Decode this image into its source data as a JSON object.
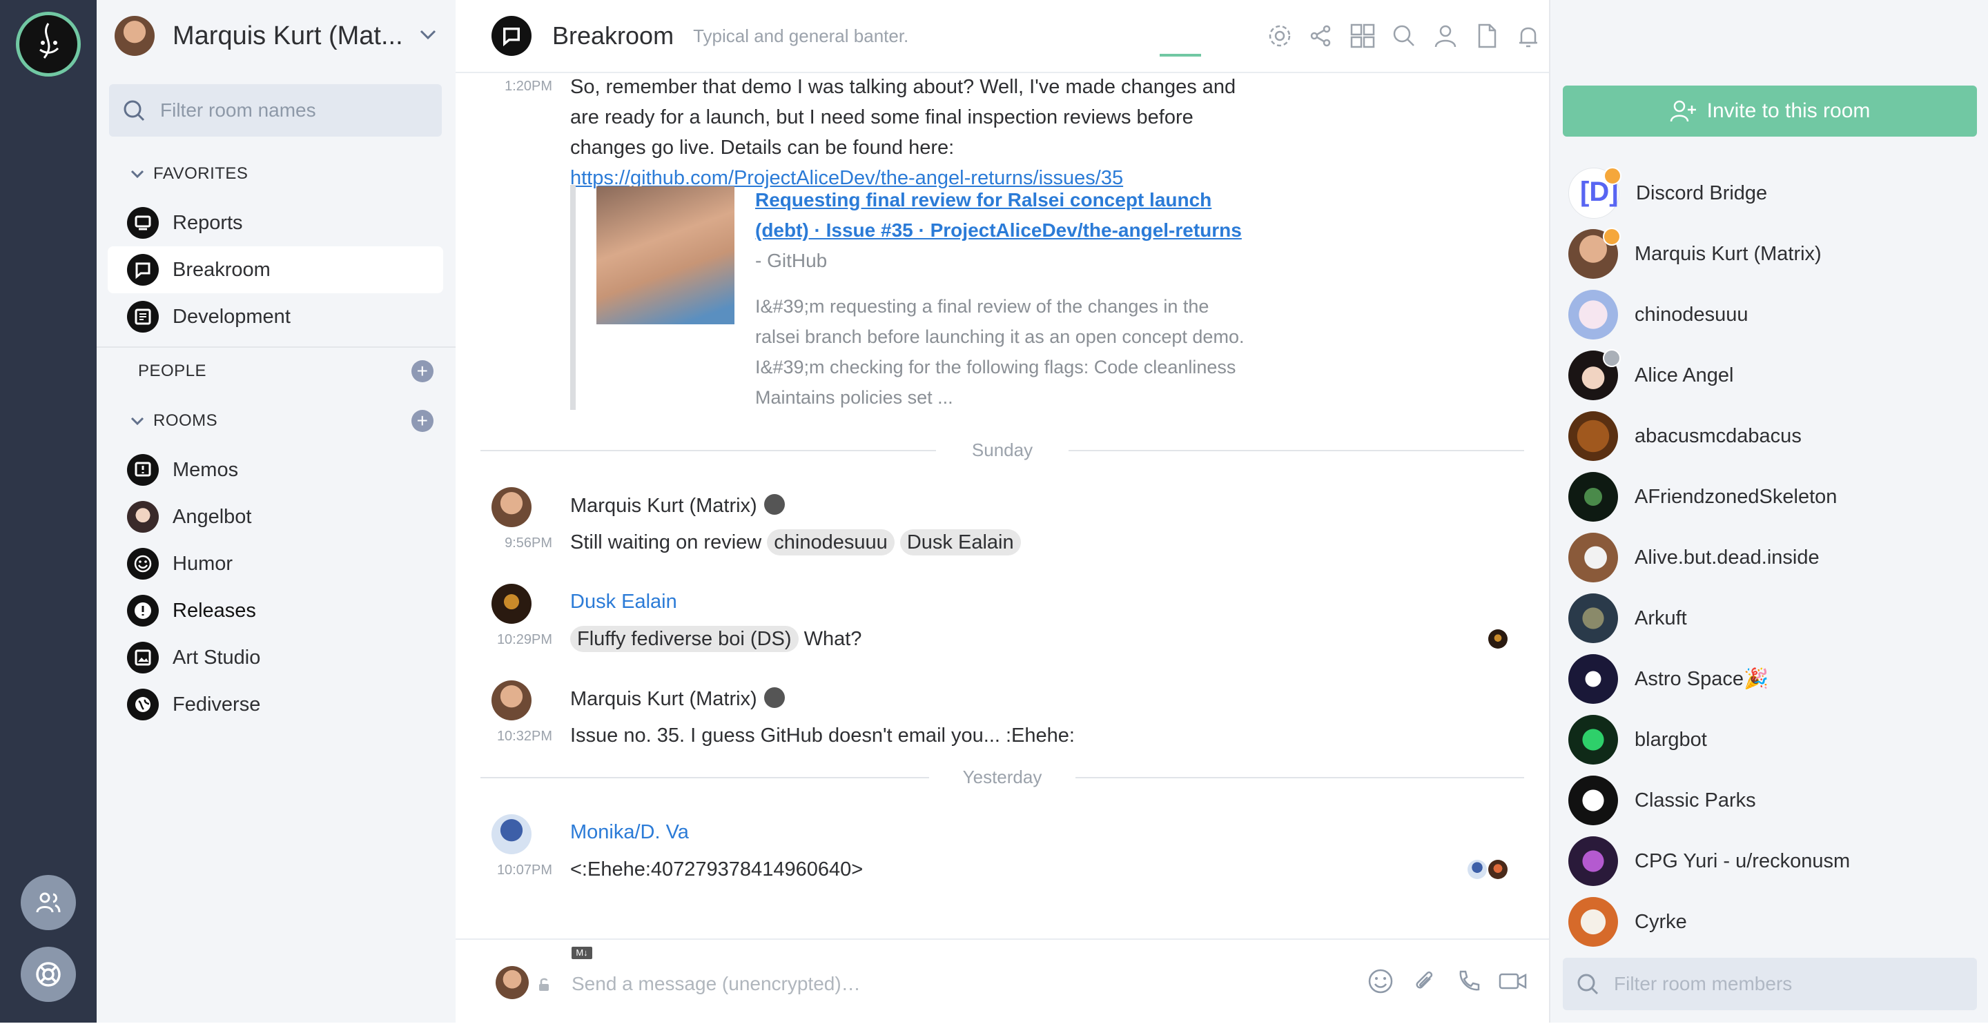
{
  "user_menu": {
    "name": "Marquis Kurt (Mat..."
  },
  "room_filter": {
    "placeholder": "Filter room names"
  },
  "sections": {
    "favorites": "FAVORITES",
    "people": "PEOPLE",
    "rooms": "ROOMS"
  },
  "favorites": [
    {
      "name": "Reports",
      "icon": "report-icon"
    },
    {
      "name": "Breakroom",
      "icon": "chat-bubble-icon"
    },
    {
      "name": "Development",
      "icon": "code-icon"
    }
  ],
  "rooms": [
    {
      "name": "Memos",
      "icon": "memo-icon"
    },
    {
      "name": "Angelbot",
      "icon": "avatar"
    },
    {
      "name": "Humor",
      "icon": "smiley-icon"
    },
    {
      "name": "Releases",
      "icon": "alert-icon"
    },
    {
      "name": "Art Studio",
      "icon": "image-icon"
    },
    {
      "name": "Fediverse",
      "icon": "globe-icon"
    }
  ],
  "room_header": {
    "name": "Breakroom",
    "topic": "Typical and general banter."
  },
  "timeline": {
    "first_message": {
      "time": "1:20PM",
      "text_before": "So, remember that demo I was talking about? Well, I've made changes and are ready for a launch, but I need some final inspection reviews before changes go live. Details can be found here: ",
      "link": "https://github.com/ProjectAliceDev/the-angel-returns/issues/35"
    },
    "preview": {
      "title_link": "Requesting final review for Ralsei concept launch (debt) · Issue #35 · ProjectAliceDev/the-angel-returns",
      "site": " - GitHub",
      "description": "I&#39;m requesting a final review of the changes in the ralsei branch before launching it as an open concept demo. I&#39;m checking for the following flags: Code cleanliness Maintains policies set ..."
    },
    "day1": "Sunday",
    "msg2": {
      "sender": "Marquis Kurt (Matrix)",
      "time": "9:56PM",
      "text": "Still waiting on review",
      "pill1": "chinodesuuu",
      "pill2": "Dusk Ealain"
    },
    "msg3": {
      "sender": "Dusk Ealain",
      "time": "10:29PM",
      "pill": "Fluffy fediverse boi (DS)",
      "text": "What?"
    },
    "msg4": {
      "sender": "Marquis Kurt (Matrix)",
      "time": "10:32PM",
      "text": "Issue no. 35. I guess GitHub doesn't email you... :Ehehe:"
    },
    "day2": "Yesterday",
    "msg5": {
      "sender": "Monika/D. Va",
      "time": "10:07PM",
      "text": "<:Ehehe:407279378414960640>"
    }
  },
  "composer": {
    "placeholder": "Send a message (unencrypted)…",
    "markdown_badge": "M↓"
  },
  "right_panel": {
    "invite_label": "Invite to this room",
    "members": [
      {
        "name": "Discord Bridge",
        "badge": "gold"
      },
      {
        "name": "Marquis Kurt (Matrix)",
        "badge": "gold"
      },
      {
        "name": "chinodesuuu"
      },
      {
        "name": "Alice Angel",
        "badge": "grey"
      },
      {
        "name": "abacusmcdabacus"
      },
      {
        "name": "AFriendzonedSkeleton"
      },
      {
        "name": "Alive.but.dead.inside"
      },
      {
        "name": "Arkuft"
      },
      {
        "name": "Astro Space🎉"
      },
      {
        "name": "blargbot"
      },
      {
        "name": "Classic Parks"
      },
      {
        "name": "CPG Yuri - u/reckonusm"
      },
      {
        "name": "Cyrke"
      }
    ],
    "filter_placeholder": "Filter room members"
  },
  "colors": {
    "accent": "#71c8a3",
    "link": "#2b7bd7",
    "strip": "#2e3648"
  }
}
